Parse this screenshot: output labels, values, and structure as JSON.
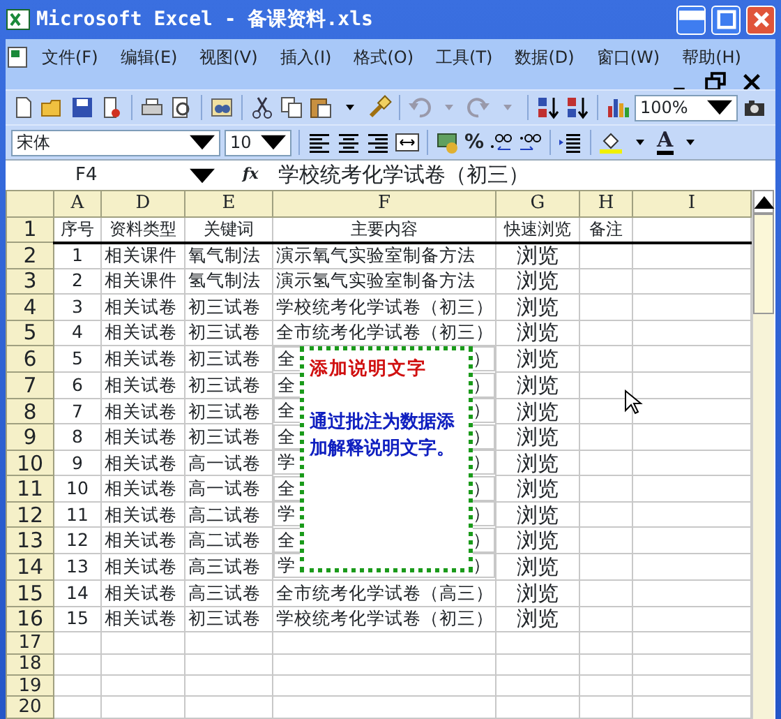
{
  "window": {
    "title": "Microsoft Excel - 备课资料.xls"
  },
  "menu": [
    "文件(F)",
    "编辑(E)",
    "视图(V)",
    "插入(I)",
    "格式(O)",
    "工具(T)",
    "数据(D)",
    "窗口(W)",
    "帮助(H)"
  ],
  "zoom": "100%",
  "font": {
    "name": "宋体",
    "size": "10",
    "percent_glyph": "%",
    "font_color_glyph": "A"
  },
  "formula_bar": {
    "name_box": "F4",
    "fx": "fx",
    "content": "学校统考化学试卷（初三）"
  },
  "columns": [
    "A",
    "D",
    "E",
    "F",
    "G",
    "H",
    "I"
  ],
  "rows": [
    {
      "num": "1",
      "cells": [
        "序号",
        "资料类型",
        "关键词",
        "主要内容",
        "快速浏览",
        "备注",
        ""
      ],
      "header": true
    },
    {
      "num": "2",
      "cells": [
        "1",
        "相关课件",
        "氧气制法",
        "演示氧气实验室制备方法",
        "浏览"
      ]
    },
    {
      "num": "3",
      "cells": [
        "2",
        "相关课件",
        "氢气制法",
        "演示氢气实验室制备方法",
        "浏览"
      ]
    },
    {
      "num": "4",
      "cells": [
        "3",
        "相关试卷",
        "初三试卷",
        "学校统考化学试卷（初三）",
        "浏览"
      ]
    },
    {
      "num": "5",
      "cells": [
        "4",
        "相关试卷",
        "初三试卷",
        "全市统考化学试卷（初三）",
        "浏览"
      ]
    },
    {
      "num": "6",
      "cells": [
        "5",
        "相关试卷",
        "初三试卷",
        "全",
        "浏览"
      ],
      "f_end": "）"
    },
    {
      "num": "7",
      "cells": [
        "6",
        "相关试卷",
        "初三试卷",
        "全",
        "浏览"
      ],
      "f_end": "）"
    },
    {
      "num": "8",
      "cells": [
        "7",
        "相关试卷",
        "初三试卷",
        "全",
        "浏览"
      ],
      "f_end": "）"
    },
    {
      "num": "9",
      "cells": [
        "8",
        "相关试卷",
        "初三试卷",
        "全",
        "浏览"
      ],
      "f_end": "）"
    },
    {
      "num": "10",
      "cells": [
        "9",
        "相关试卷",
        "高一试卷",
        "学",
        "浏览"
      ],
      "f_end": "）"
    },
    {
      "num": "11",
      "cells": [
        "10",
        "相关试卷",
        "高一试卷",
        "全",
        "浏览"
      ],
      "f_end": "）"
    },
    {
      "num": "12",
      "cells": [
        "11",
        "相关试卷",
        "高二试卷",
        "学",
        "浏览"
      ],
      "f_end": "）"
    },
    {
      "num": "13",
      "cells": [
        "12",
        "相关试卷",
        "高二试卷",
        "全",
        "浏览"
      ],
      "f_end": "）"
    },
    {
      "num": "14",
      "cells": [
        "13",
        "相关试卷",
        "高三试卷",
        "学",
        "浏览"
      ],
      "f_end": "）"
    },
    {
      "num": "15",
      "cells": [
        "14",
        "相关试卷",
        "高三试卷",
        "全市统考化学试卷（高三）",
        "浏览"
      ]
    },
    {
      "num": "16",
      "cells": [
        "15",
        "相关试卷",
        "初三试卷",
        "学校统考化学试卷（初三）",
        "浏览"
      ]
    },
    {
      "num": "17",
      "cells": []
    },
    {
      "num": "18",
      "cells": []
    },
    {
      "num": "19",
      "cells": []
    },
    {
      "num": "20",
      "cells": []
    }
  ],
  "comment": {
    "title": "添加说明文字",
    "text": "通过批注为数据添加解释说明文字。"
  }
}
